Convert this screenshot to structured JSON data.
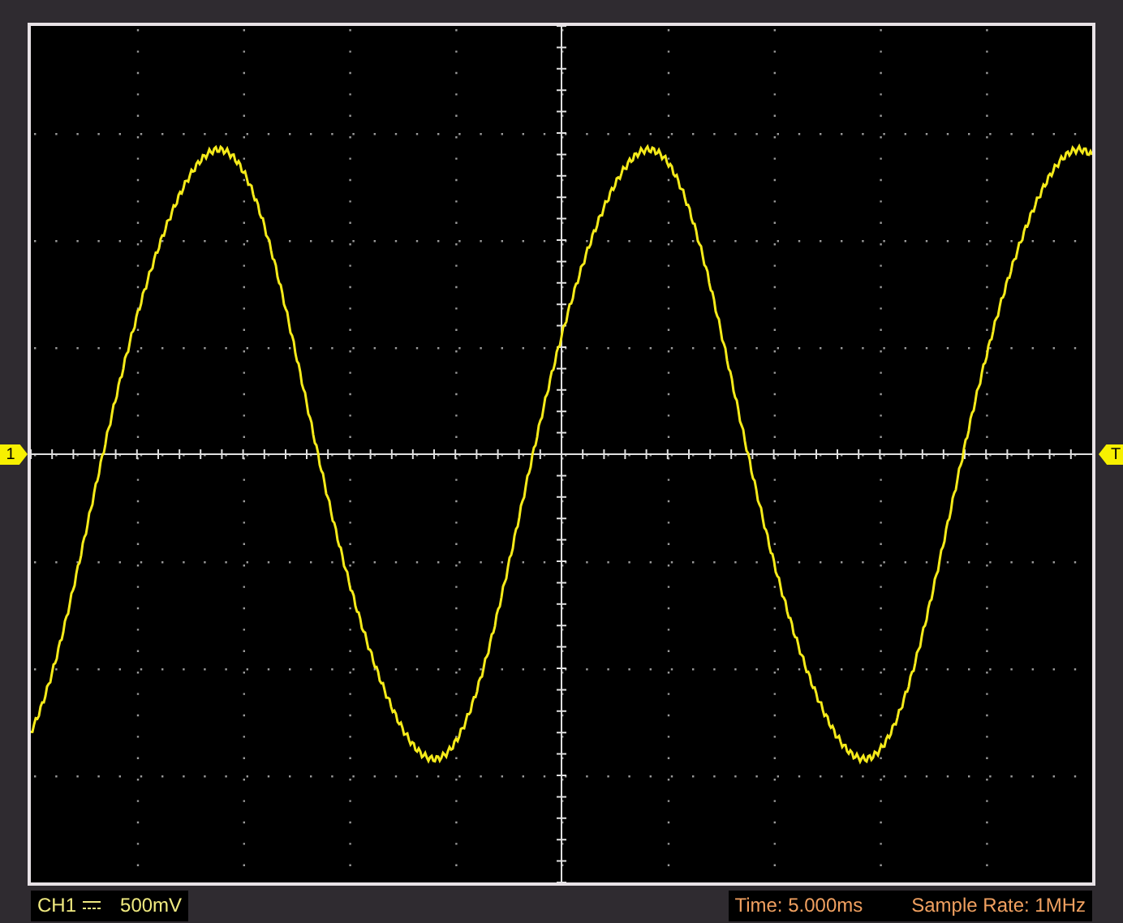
{
  "channel_marker": {
    "label": "1"
  },
  "trigger_marker": {
    "label": "T"
  },
  "status_bar": {
    "channel": "CH1",
    "scale": "500mV",
    "time": "Time: 5.000ms",
    "sample_rate": "Sample Rate: 1MHz"
  }
}
